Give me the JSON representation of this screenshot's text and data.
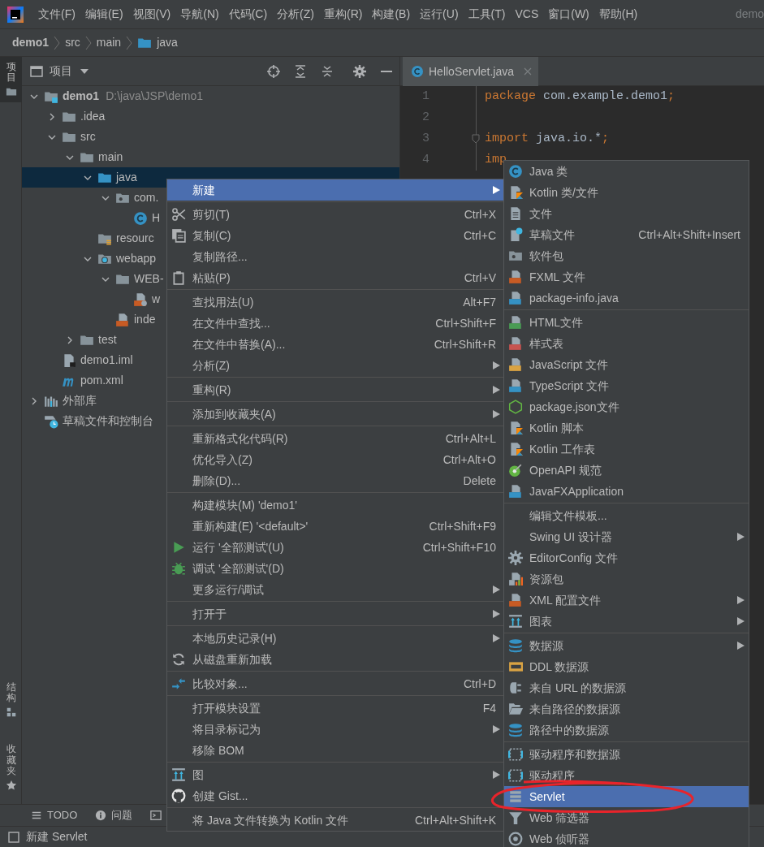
{
  "menubar": {
    "items": [
      "文件(F)",
      "编辑(E)",
      "视图(V)",
      "导航(N)",
      "代码(C)",
      "分析(Z)",
      "重构(R)",
      "构建(B)",
      "运行(U)",
      "工具(T)",
      "VCS",
      "窗口(W)",
      "帮助(H)"
    ],
    "title": "demo"
  },
  "breadcrumb": [
    {
      "label": "demo1",
      "kind": "module"
    },
    {
      "label": "src",
      "kind": "plain"
    },
    {
      "label": "main",
      "kind": "plain"
    },
    {
      "label": "java",
      "kind": "folder"
    }
  ],
  "left_strip": {
    "top": [
      {
        "label": "项目",
        "selected": true
      }
    ],
    "bottom": [
      {
        "label": "结构",
        "selected": false
      },
      {
        "label": "收藏夹",
        "selected": false
      }
    ]
  },
  "project_panel": {
    "title": "项目",
    "tree": [
      {
        "label": "demo1",
        "path": "D:\\java\\JSP\\demo1",
        "kind": "module",
        "expanded": true,
        "selected": false,
        "children": [
          {
            "label": ".idea",
            "kind": "folder",
            "expanded": false,
            "selected": false
          },
          {
            "label": "src",
            "kind": "folder",
            "expanded": true,
            "selected": false,
            "children": [
              {
                "label": "main",
                "kind": "folder",
                "expanded": true,
                "selected": false,
                "children": [
                  {
                    "label": "java",
                    "kind": "source-folder",
                    "expanded": true,
                    "selected": true,
                    "children": [
                      {
                        "label": "com.",
                        "kind": "package",
                        "expanded": true,
                        "selected": false,
                        "children": [
                          {
                            "label": "H",
                            "kind": "class",
                            "selected": false
                          }
                        ]
                      }
                    ]
                  },
                  {
                    "label": "resourc",
                    "kind": "resources",
                    "selected": false
                  },
                  {
                    "label": "webapp",
                    "kind": "web",
                    "expanded": true,
                    "selected": false,
                    "children": [
                      {
                        "label": "WEB-",
                        "kind": "folder",
                        "expanded": true,
                        "selected": false,
                        "children": [
                          {
                            "label": "w",
                            "kind": "web-xml",
                            "selected": false
                          }
                        ]
                      },
                      {
                        "label": "inde",
                        "kind": "jsp",
                        "selected": false
                      }
                    ]
                  }
                ]
              },
              {
                "label": "test",
                "kind": "folder",
                "expanded": false,
                "selected": false
              }
            ]
          },
          {
            "label": "demo1.iml",
            "kind": "iml",
            "selected": false
          },
          {
            "label": "pom.xml",
            "kind": "maven",
            "selected": false
          }
        ]
      },
      {
        "label": "外部库",
        "kind": "libraries",
        "expanded": false,
        "selected": false
      },
      {
        "label": "草稿文件和控制台",
        "kind": "scratches",
        "selected": false
      }
    ]
  },
  "editor": {
    "tabs": [
      {
        "label": "HelloServlet.java",
        "selected": true
      }
    ],
    "lines": [
      {
        "number": "1",
        "tokens": [
          {
            "text": "package",
            "kind": "keyword"
          },
          {
            "text": " com.example.demo1",
            "kind": "plain"
          },
          {
            "text": ";",
            "kind": "keyword"
          }
        ]
      },
      {
        "number": "2"
      },
      {
        "number": "3",
        "fold": true,
        "tokens": [
          {
            "text": "import",
            "kind": "keyword"
          },
          {
            "text": " java.io.*",
            "kind": "plain"
          },
          {
            "text": ";",
            "kind": "keyword"
          }
        ]
      },
      {
        "number": "4",
        "tokens": [
          {
            "text": "imp",
            "kind": "keyword"
          }
        ]
      }
    ]
  },
  "context_menu": {
    "items": [
      {
        "kind": "plain",
        "label": "新建",
        "submenu": true,
        "selected": true
      },
      {
        "kind": "separator"
      },
      {
        "kind": "cut",
        "label": "剪切(T)",
        "shortcut": "Ctrl+X",
        "selected": false
      },
      {
        "kind": "copy",
        "label": "复制(C)",
        "shortcut": "Ctrl+C",
        "selected": false
      },
      {
        "kind": "plain",
        "label": "复制路径...",
        "selected": false
      },
      {
        "kind": "paste",
        "label": "粘贴(P)",
        "shortcut": "Ctrl+V",
        "selected": false
      },
      {
        "kind": "separator"
      },
      {
        "kind": "plain",
        "label": "查找用法(U)",
        "shortcut": "Alt+F7",
        "selected": false
      },
      {
        "kind": "plain",
        "label": "在文件中查找...",
        "shortcut": "Ctrl+Shift+F",
        "selected": false
      },
      {
        "kind": "plain",
        "label": "在文件中替换(A)...",
        "shortcut": "Ctrl+Shift+R",
        "selected": false
      },
      {
        "kind": "plain",
        "label": "分析(Z)",
        "submenu": true,
        "selected": false
      },
      {
        "kind": "separator"
      },
      {
        "kind": "plain",
        "label": "重构(R)",
        "submenu": true,
        "selected": false
      },
      {
        "kind": "separator"
      },
      {
        "kind": "plain",
        "label": "添加到收藏夹(A)",
        "submenu": true,
        "selected": false
      },
      {
        "kind": "separator"
      },
      {
        "kind": "plain",
        "label": "重新格式化代码(R)",
        "shortcut": "Ctrl+Alt+L",
        "selected": false
      },
      {
        "kind": "plain",
        "label": "优化导入(Z)",
        "shortcut": "Ctrl+Alt+O",
        "selected": false
      },
      {
        "kind": "plain",
        "label": "删除(D)...",
        "shortcut": "Delete",
        "selected": false
      },
      {
        "kind": "separator"
      },
      {
        "kind": "plain",
        "label": "构建模块(M) 'demo1'",
        "selected": false
      },
      {
        "kind": "plain",
        "label": "重新构建(E) '<default>'",
        "shortcut": "Ctrl+Shift+F9",
        "selected": false
      },
      {
        "kind": "run",
        "label": "运行 '全部测试'(U)",
        "shortcut": "Ctrl+Shift+F10",
        "selected": false
      },
      {
        "kind": "debug",
        "label": "调试 '全部测试'(D)",
        "selected": false
      },
      {
        "kind": "plain",
        "label": "更多运行/调试",
        "submenu": true,
        "selected": false
      },
      {
        "kind": "separator"
      },
      {
        "kind": "plain",
        "label": "打开于",
        "submenu": true,
        "selected": false
      },
      {
        "kind": "separator"
      },
      {
        "kind": "plain",
        "label": "本地历史记录(H)",
        "submenu": true,
        "selected": false
      },
      {
        "kind": "reload",
        "label": "从磁盘重新加载",
        "selected": false
      },
      {
        "kind": "separator"
      },
      {
        "kind": "compare",
        "label": "比较对象...",
        "shortcut": "Ctrl+D",
        "selected": false
      },
      {
        "kind": "separator"
      },
      {
        "kind": "plain",
        "label": "打开模块设置",
        "shortcut": "F4",
        "selected": false
      },
      {
        "kind": "plain",
        "label": "将目录标记为",
        "submenu": true,
        "selected": false
      },
      {
        "kind": "plain",
        "label": "移除 BOM",
        "selected": false
      },
      {
        "kind": "separator"
      },
      {
        "kind": "diagram",
        "label": "图",
        "submenu": true,
        "selected": false
      },
      {
        "kind": "github",
        "label": "创建 Gist...",
        "selected": false
      },
      {
        "kind": "separator"
      },
      {
        "kind": "plain",
        "label": "将 Java 文件转换为 Kotlin 文件",
        "shortcut": "Ctrl+Alt+Shift+K",
        "selected": false
      }
    ]
  },
  "submenu": {
    "items": [
      {
        "kind": "class",
        "label": "Java 类",
        "selected": false,
        "circled": false
      },
      {
        "kind": "kotlin",
        "label": "Kotlin 类/文件",
        "selected": false,
        "circled": false
      },
      {
        "kind": "file",
        "label": "文件",
        "selected": false,
        "circled": false
      },
      {
        "kind": "scratch",
        "label": "草稿文件",
        "shortcut": "Ctrl+Alt+Shift+Insert",
        "selected": false,
        "circled": false
      },
      {
        "kind": "package",
        "label": "软件包",
        "selected": false,
        "circled": false
      },
      {
        "kind": "fxml",
        "label": "FXML 文件",
        "selected": false,
        "circled": false
      },
      {
        "kind": "java-file",
        "label": "package-info.java",
        "selected": false,
        "circled": false
      },
      {
        "kind": "separator"
      },
      {
        "kind": "html",
        "label": "HTML文件",
        "selected": false,
        "circled": false
      },
      {
        "kind": "css",
        "label": "样式表",
        "selected": false,
        "circled": false
      },
      {
        "kind": "js",
        "label": "JavaScript 文件",
        "selected": false,
        "circled": false
      },
      {
        "kind": "ts",
        "label": "TypeScript 文件",
        "selected": false,
        "circled": false
      },
      {
        "kind": "nodejs",
        "label": "package.json文件",
        "selected": false,
        "circled": false
      },
      {
        "kind": "kotlin",
        "label": "Kotlin 脚本",
        "selected": false,
        "circled": false
      },
      {
        "kind": "kotlin",
        "label": "Kotlin 工作表",
        "selected": false,
        "circled": false
      },
      {
        "kind": "openapi",
        "label": "OpenAPI 规范",
        "selected": false,
        "circled": false
      },
      {
        "kind": "java-file",
        "label": "JavaFXApplication",
        "selected": false,
        "circled": false
      },
      {
        "kind": "separator"
      },
      {
        "kind": "plain",
        "label": "编辑文件模板...",
        "selected": false,
        "circled": false
      },
      {
        "kind": "plain",
        "label": "Swing UI 设计器",
        "submenu": true,
        "selected": false,
        "circled": false
      },
      {
        "kind": "gear",
        "label": "EditorConfig 文件",
        "selected": false,
        "circled": false
      },
      {
        "kind": "bundle",
        "label": "资源包",
        "selected": false,
        "circled": false
      },
      {
        "kind": "fxml",
        "label": "XML 配置文件",
        "submenu": true,
        "selected": false,
        "circled": false
      },
      {
        "kind": "diagram",
        "label": "图表",
        "submenu": true,
        "selected": false,
        "circled": false
      },
      {
        "kind": "separator"
      },
      {
        "kind": "database",
        "label": "数据源",
        "submenu": true,
        "selected": false,
        "circled": false
      },
      {
        "kind": "ddl",
        "label": "DDL 数据源",
        "selected": false,
        "circled": false
      },
      {
        "kind": "plug",
        "label": "来自 URL 的数据源",
        "selected": false,
        "circled": false
      },
      {
        "kind": "folder-open",
        "label": "来自路径的数据源",
        "selected": false,
        "circled": false
      },
      {
        "kind": "database",
        "label": "路径中的数据源",
        "selected": false,
        "circled": false
      },
      {
        "kind": "separator"
      },
      {
        "kind": "driver",
        "label": "驱动程序和数据源",
        "selected": false,
        "circled": false
      },
      {
        "kind": "driver",
        "label": "驱动程序",
        "selected": false,
        "circled": false
      },
      {
        "kind": "servlet",
        "label": "Servlet",
        "selected": true,
        "circled": true
      },
      {
        "kind": "filter",
        "label": "Web 筛选器",
        "selected": false,
        "circled": false
      },
      {
        "kind": "listener",
        "label": "Web 侦听器",
        "selected": false,
        "circled": false
      }
    ]
  },
  "bottom_tools": [
    {
      "label": "TODO",
      "kind": "list"
    },
    {
      "label": "问题",
      "kind": "info"
    },
    {
      "kind": "terminal"
    }
  ],
  "status_bar": {
    "text": "新建 Servlet"
  }
}
